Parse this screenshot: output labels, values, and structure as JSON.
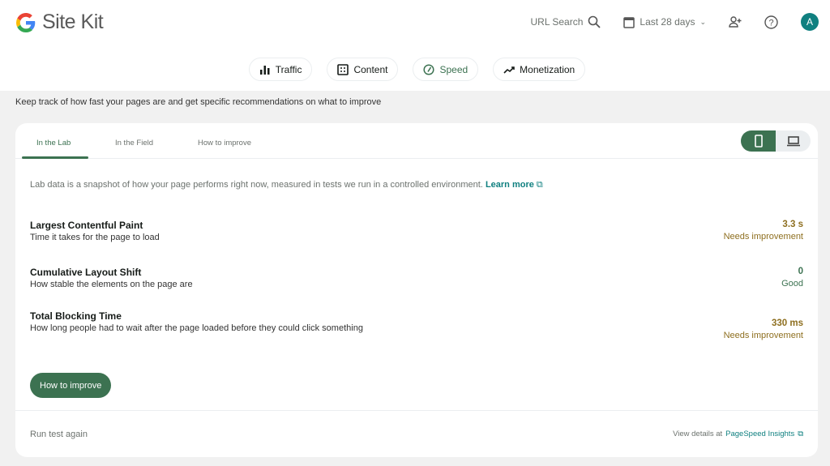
{
  "header": {
    "app_name": "Site Kit",
    "url_search": "URL Search",
    "date_range": "Last 28 days",
    "avatar_letter": "A"
  },
  "nav": {
    "chips": [
      {
        "label": "Traffic"
      },
      {
        "label": "Content"
      },
      {
        "label": "Speed"
      },
      {
        "label": "Monetization"
      }
    ]
  },
  "page": {
    "subtitle": "Keep track of how fast your pages are and get specific recommendations on what to improve"
  },
  "card": {
    "tabs": [
      {
        "label": "In the Lab"
      },
      {
        "label": "In the Field"
      },
      {
        "label": "How to improve"
      }
    ],
    "intro": "Lab data is a snapshot of how your page performs right now, measured in tests we run in a controlled environment.",
    "learn_more": "Learn more",
    "metrics": [
      {
        "name": "Largest Contentful Paint",
        "desc": "Time it takes for the page to load",
        "value": "3.3 s",
        "status": "Needs improvement"
      },
      {
        "name": "Cumulative Layout Shift",
        "desc": "How stable the elements on the page are",
        "value": "0",
        "status": "Good"
      },
      {
        "name": "Total Blocking Time",
        "desc": "How long people had to wait after the page loaded before they could click something",
        "value": "330 ms",
        "status": "Needs improvement"
      }
    ],
    "improve_button": "How to improve",
    "run_again": "Run test again",
    "view_details": "View details at",
    "psi_link": "PageSpeed Insights"
  },
  "colors": {
    "accent": "#3c7251",
    "warn": "#8e6f20",
    "link": "#108080"
  }
}
